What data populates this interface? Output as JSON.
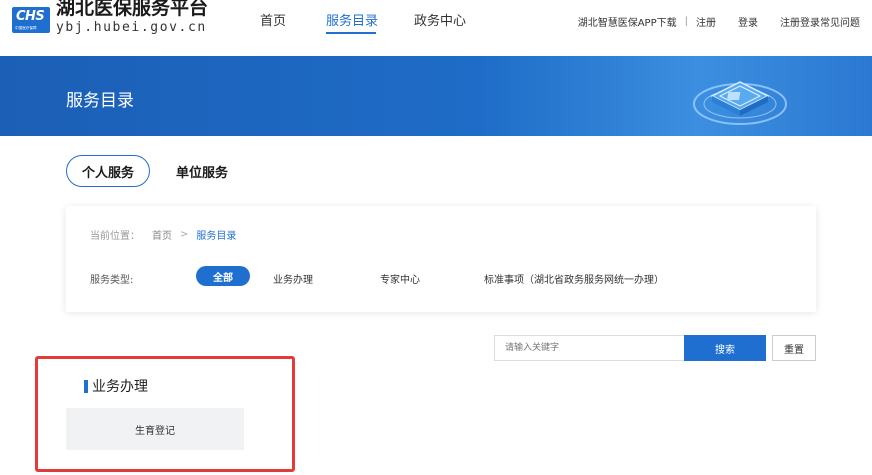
{
  "header": {
    "logo": {
      "mark_text": "CHS",
      "mark_sub": "中国医疗保障",
      "title": "湖北医保服务平台",
      "domain": "ybj.hubei.gov.cn"
    },
    "nav": [
      {
        "label": "首页",
        "active": false
      },
      {
        "label": "服务目录",
        "active": true
      },
      {
        "label": "政务中心",
        "active": false
      }
    ],
    "links": {
      "app_download": "湖北智慧医保APP下载",
      "separator": "|",
      "register": "注册",
      "login": "登录",
      "faq": "注册登录常见问题"
    }
  },
  "banner": {
    "title": "服务目录"
  },
  "tabs": {
    "personal": "个人服务",
    "unit": "单位服务"
  },
  "filter": {
    "breadcrumb": {
      "label": "当前位置：",
      "home": "首页",
      "arrow": ">",
      "current": "服务目录"
    },
    "types": {
      "label": "服务类型:",
      "all": "全部",
      "business": "业务办理",
      "expert": "专家中心",
      "standard": "标准事项（湖北省政务服务网统一办理）"
    }
  },
  "search": {
    "placeholder": "请输入关键字",
    "button": "搜索",
    "reset": "重置"
  },
  "section": {
    "title": "业务办理",
    "items": [
      "生育登记"
    ]
  },
  "colors": {
    "primary": "#1f6fd1",
    "highlight_border": "#e53a3a",
    "card_bg": "#f0f2f4"
  }
}
